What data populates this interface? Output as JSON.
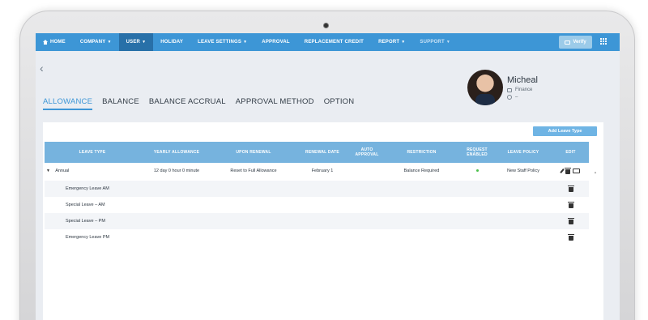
{
  "nav": {
    "items": [
      {
        "label": "HOME",
        "has_caret": false
      },
      {
        "label": "COMPANY",
        "has_caret": true
      },
      {
        "label": "USER",
        "has_caret": true
      },
      {
        "label": "HOLIDAY",
        "has_caret": false
      },
      {
        "label": "LEAVE SETTINGS",
        "has_caret": true
      },
      {
        "label": "APPROVAL",
        "has_caret": false
      },
      {
        "label": "REPLACEMENT CREDIT",
        "has_caret": false
      },
      {
        "label": "REPORT",
        "has_caret": true
      },
      {
        "label": "SUPPORT",
        "has_caret": true
      }
    ],
    "active": "USER",
    "verify_label": "Verify",
    "accent_color": "#3d96d6",
    "active_color": "#2870a8"
  },
  "tabs": [
    {
      "label": "ALLOWANCE"
    },
    {
      "label": "BALANCE"
    },
    {
      "label": "BALANCE ACCRUAL"
    },
    {
      "label": "APPROVAL METHOD"
    },
    {
      "label": "OPTION"
    }
  ],
  "active_tab": "ALLOWANCE",
  "profile": {
    "name": "Micheal",
    "department": "Finance",
    "extra": "–"
  },
  "table": {
    "add_button_label": "Add Leave Type",
    "headers": {
      "leave_type": "LEAVE TYPE",
      "yearly_allowance": "YEARLY ALLOWANCE",
      "upon_renewal": "UPON RENEWAL",
      "renewal_date": "RENEWAL DATE",
      "auto_approval": "AUTO APPROVAL",
      "restriction": "RESTRICTION",
      "request_enabled": "REQUEST ENABLED",
      "leave_policy": "LEAVE POLICY",
      "edit": "EDIT"
    },
    "rows": [
      {
        "leave_type": "Annual",
        "yearly_allowance": "12 day 0 hour 0 minute",
        "upon_renewal": "Reset to Full Allowance",
        "renewal_date": "February 1",
        "auto_approval": "",
        "restriction": "Balance Required",
        "request_enabled": true,
        "leave_policy": "New Staff Policy"
      },
      {
        "leave_type": "Emergency Leave AM"
      },
      {
        "leave_type": "Special Leave – AM"
      },
      {
        "leave_type": "Special Leave – PM"
      },
      {
        "leave_type": "Emergency Leave PM"
      }
    ]
  }
}
